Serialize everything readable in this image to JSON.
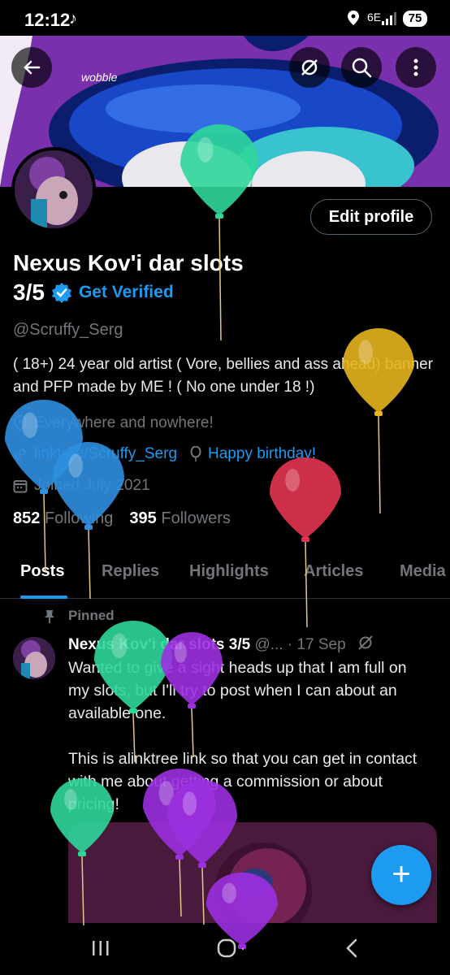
{
  "status_bar": {
    "time": "12:12",
    "network": "6E",
    "battery": "75"
  },
  "banner": {
    "text": "wobble"
  },
  "profile": {
    "edit_label": "Edit profile",
    "display_name_line1": "Nexus Kov'i dar slots",
    "display_name_line2": "3/5",
    "get_verified": "Get Verified",
    "handle": "@Scruffy_Serg",
    "bio": "( 18+) 24 year old artist ( Vore, bellies and ass ahead) banner and PFP made by ME ! ( No one under 18 !)",
    "location": "Everywhere and nowhere!",
    "link": "linktree/Scruffy_Serg",
    "birthday": "Happy birthday!",
    "joined": "Joined July 2021",
    "following_count": "852",
    "following_label": "Following",
    "followers_count": "395",
    "followers_label": "Followers"
  },
  "tabs": [
    "Posts",
    "Replies",
    "Highlights",
    "Articles",
    "Media"
  ],
  "pinned_post": {
    "pinned_label": "Pinned",
    "author": "Nexus Kov'i dar slots 3/5",
    "handle": "@...",
    "date": "· 17 Sep",
    "text_p1": "Wanted to give a sight heads up that I am full on my slots, but I'll try to post when I can about an available one.",
    "text_p2": "This is  alinktree link so that you can get in contact with me about getting a commission or about pricing!"
  },
  "colors": {
    "accent": "#1d9bf0",
    "balloon_green": "#2fd69a",
    "balloon_yellow": "#e6b41f",
    "balloon_blue": "#2f8fe0",
    "balloon_red": "#e2344f",
    "balloon_purple": "#9b30e0"
  },
  "icons": [
    "back-arrow-icon",
    "refresh-off-icon",
    "search-icon",
    "more-icon",
    "verified-badge-icon",
    "location-icon",
    "link-icon",
    "balloon-icon",
    "calendar-icon",
    "pin-icon",
    "plus-icon"
  ]
}
